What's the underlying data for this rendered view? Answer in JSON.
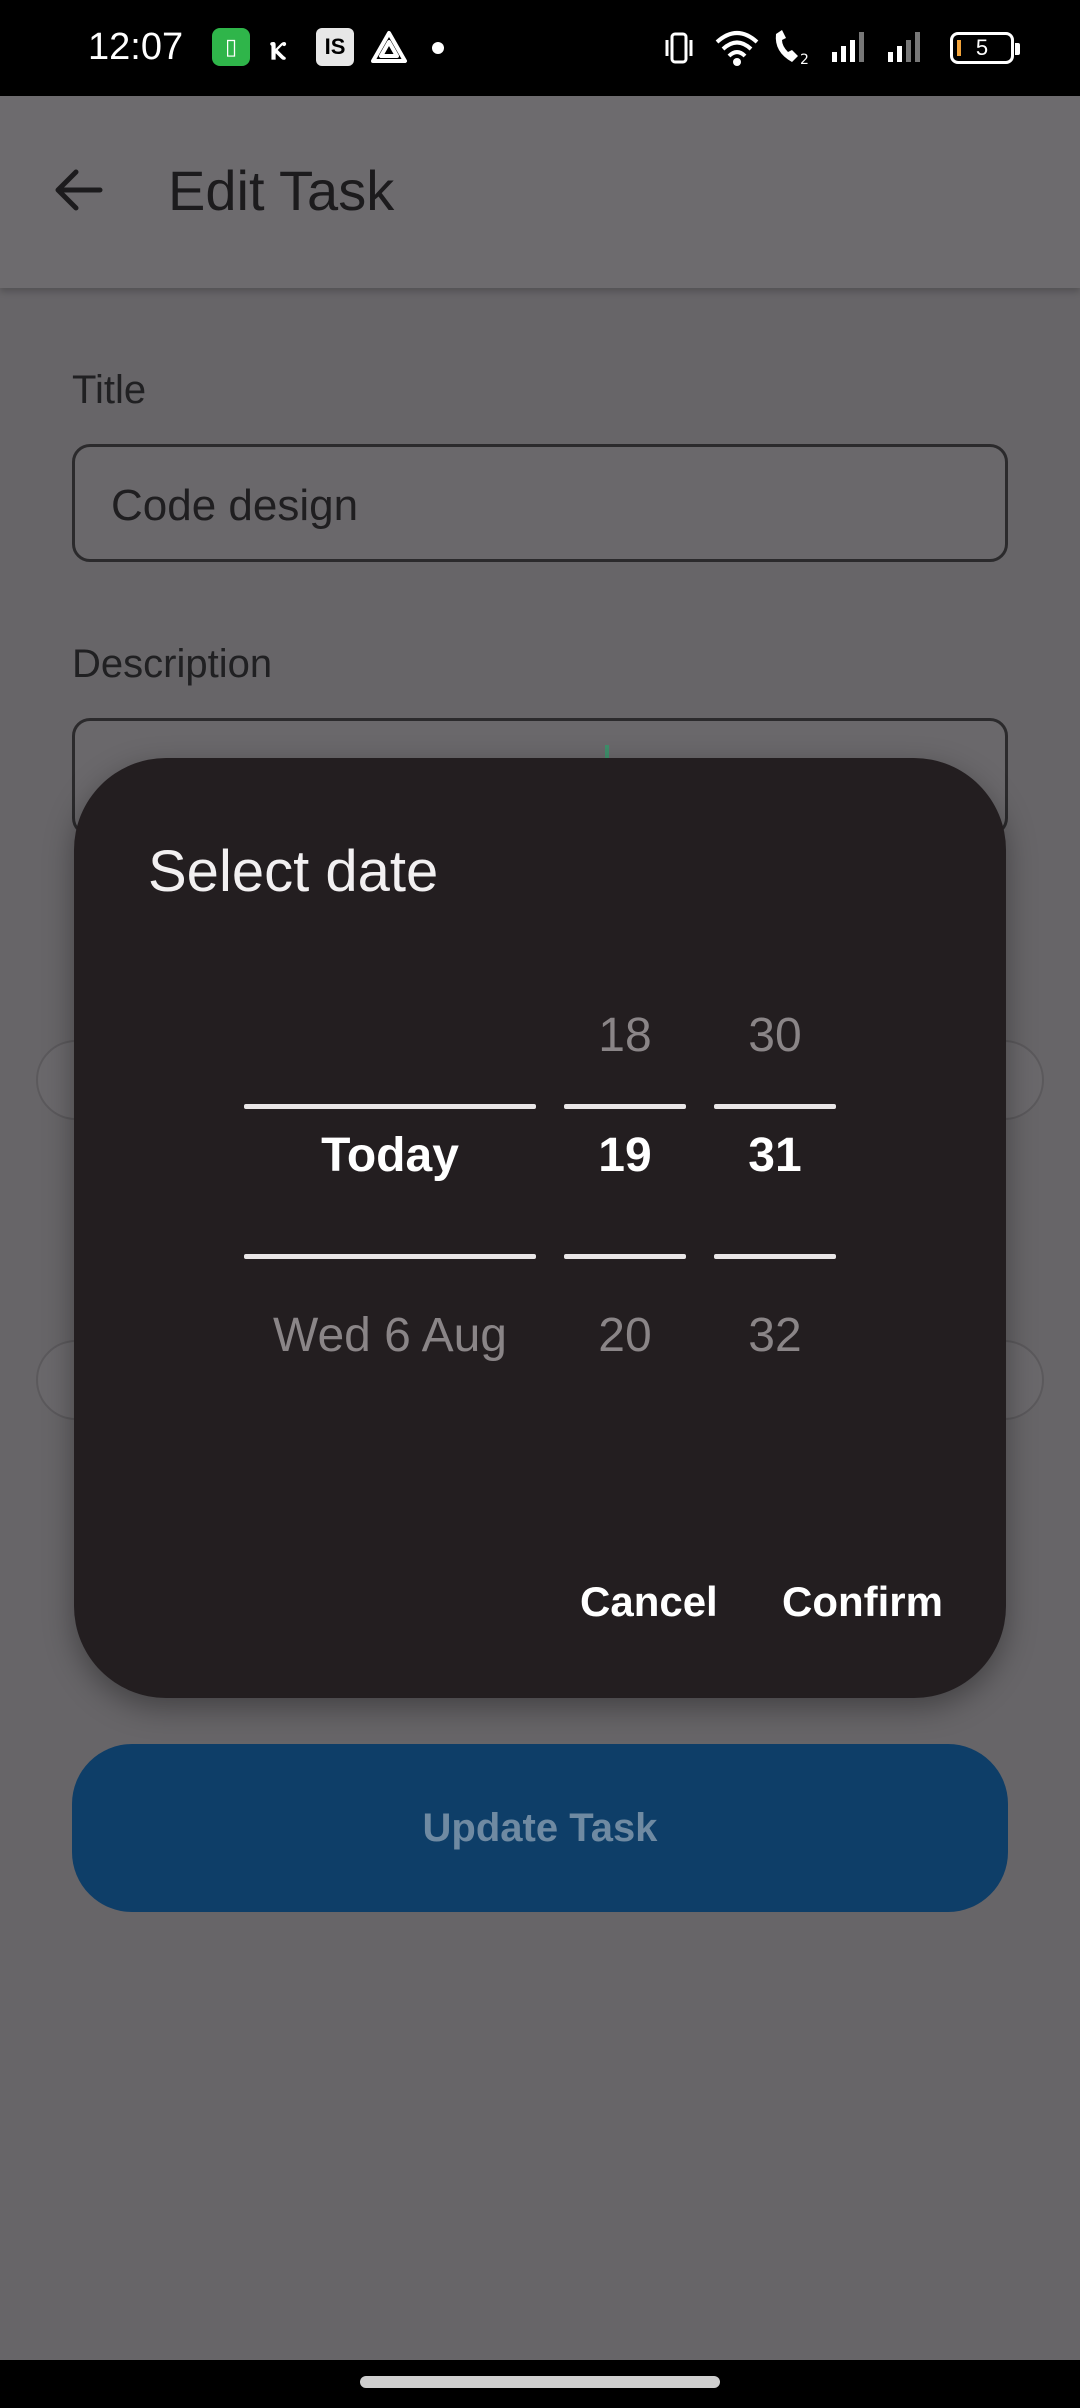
{
  "status_bar": {
    "time": "12:07",
    "notif_is": "IS",
    "battery": "5"
  },
  "app_bar": {
    "title": "Edit Task",
    "back_icon": "arrow-back-icon"
  },
  "form": {
    "title_label": "Title",
    "title_value": "Code design",
    "description_label": "Description",
    "update_button": "Update Task"
  },
  "dialog": {
    "title": "Select date",
    "day_column": {
      "prev": "",
      "selected": "Today",
      "next": "Wed 6 Aug"
    },
    "hour_column": {
      "prev": "18",
      "selected": "19",
      "next": "20"
    },
    "minute_column": {
      "prev": "30",
      "selected": "31",
      "next": "32"
    },
    "cancel": "Cancel",
    "confirm": "Confirm"
  },
  "colors": {
    "dialog_bg": "#231e20",
    "scrim": "#676568",
    "update_button_bg": "#0e3e68",
    "accent_green": "#2fb54a"
  }
}
